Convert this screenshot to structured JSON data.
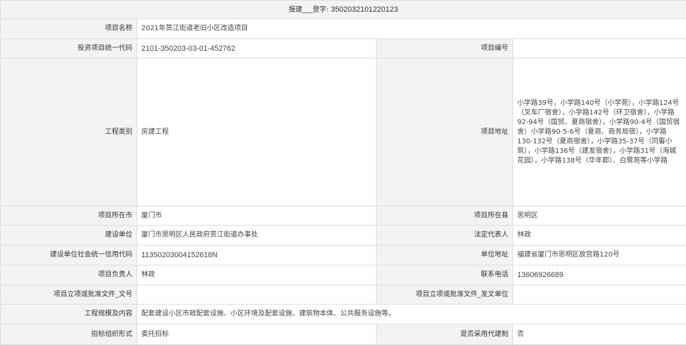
{
  "header": {
    "prefix": "报建",
    "label": "登字:",
    "number": "3502032101220123"
  },
  "fields": {
    "project_name": {
      "label": "项目名称",
      "value": "2021年筼江街道老旧小区改造项目"
    },
    "investment_code": {
      "label": "投资项目统一代码",
      "value": "2101-350203-03-01-452762"
    },
    "project_number": {
      "label": "项目编号",
      "value": ""
    },
    "engineering_type": {
      "label": "工程类别",
      "value": "房建工程"
    },
    "project_address": {
      "label": "项目地址",
      "value": "小学路39号，小学路140号（小学苑），小学路124号（叉车厂宿舍），小学路142号（环卫宿舍），小学路92-94号（国贸、夏商宿舍），小学路90-4号（国贸宿舍）小学路90-5-6号（夏商、商务局宿），小学路130-132号（夏商宿舍），小学路35-37号（同馨小筑），小学路136号（建发宿舍），小学路31号（海城花园），小学路138号（华年郡）、白鹭苑等小学路"
    },
    "city": {
      "label": "项目所在市",
      "value": "厦门市"
    },
    "county": {
      "label": "项目所在县",
      "value": "思明区"
    },
    "construction_unit": {
      "label": "建设单位",
      "value": "厦门市思明区人民政府筼江街道办事处"
    },
    "legal_rep": {
      "label": "法定代表人",
      "value": "林政"
    },
    "credit_code": {
      "label": "建设单位社会统一信用代码",
      "value": "11350203004152618N"
    },
    "unit_address": {
      "label": "单位地址",
      "value": "福建省厦门市思明区故宫路120号"
    },
    "project_leader": {
      "label": "项目负责人",
      "value": "林政"
    },
    "contact_phone": {
      "label": "联系电话",
      "value": "13606926689"
    },
    "approval_doc_number": {
      "label": "项目立项或批准文件_文号",
      "value": ""
    },
    "approval_doc_unit": {
      "label": "项目立项或批准文件_发文单位",
      "value": ""
    },
    "scale_content": {
      "label": "工程规模及内容",
      "value": "配套建设小区市政配套设施、小区环境及配套设施、建筑物本体、公共服务设施等。"
    },
    "tender_form": {
      "label": "招标组织形式",
      "value": "委托招标"
    },
    "agent_construction": {
      "label": "是否采用代建制",
      "value": "否"
    }
  }
}
